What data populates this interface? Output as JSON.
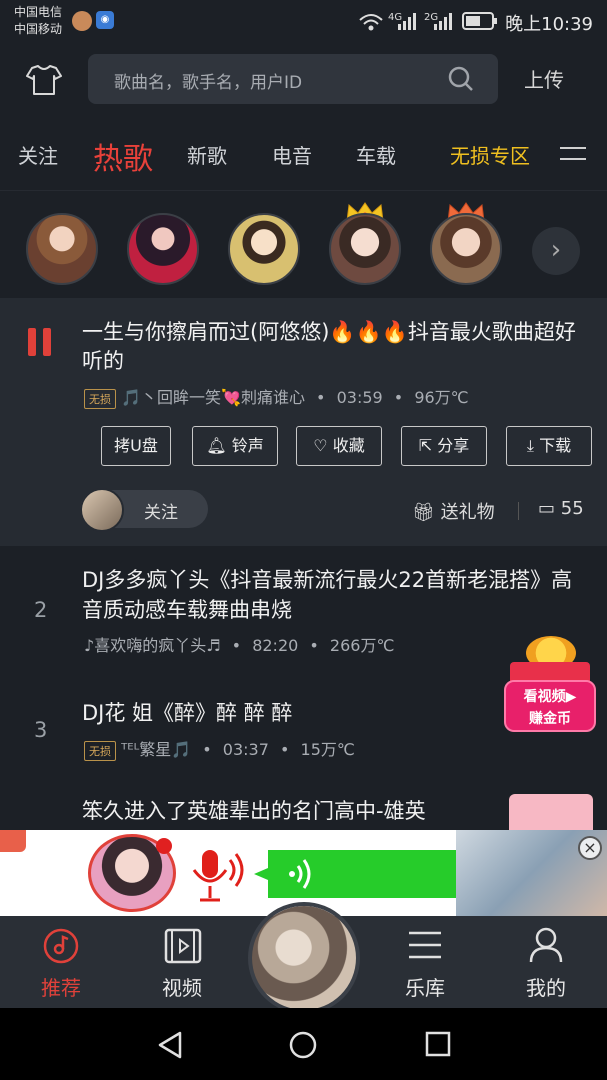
{
  "status_bar": {
    "carrier1": "中国电信",
    "carrier2": "中国移动",
    "time": "晚上10:39",
    "net1": "4G",
    "net2": "2G"
  },
  "header": {
    "search_placeholder": "歌曲名，歌手名，用户ID",
    "upload_label": "上传"
  },
  "tabs": [
    {
      "label": "关注"
    },
    {
      "label": "热歌",
      "active": true
    },
    {
      "label": "新歌"
    },
    {
      "label": "电音"
    },
    {
      "label": "车载"
    },
    {
      "label": "无损专区",
      "highlight": true
    }
  ],
  "now_playing": {
    "title": "一生与你擦肩而过(阿悠悠)🔥🔥🔥抖音最火歌曲超好听的",
    "badge": "无损",
    "uploader": "🎵丶回眸一笑💘刺痛谁心",
    "duration": "03:59",
    "plays": "96万℃",
    "actions": [
      "拷U盘",
      "铃声",
      "收藏",
      "分享",
      "下载"
    ],
    "follow_label": "关注",
    "gift_label": "送礼物",
    "comment_count": "55"
  },
  "songs": [
    {
      "rank": "2",
      "title": "DJ多多疯丫头《抖音最新流行最火22首新老混搭》高音质动感车载舞曲串烧",
      "uploader": "♪喜欢嗨的疯丫头♬",
      "duration": "82:20",
      "plays": "266万℃"
    },
    {
      "rank": "3",
      "title": "DJ花 姐《醉》醉  醉  醉",
      "badge": "无损",
      "uploader": "ᵀᴱᴸ繁星🎵",
      "duration": "03:37",
      "plays": "15万℃"
    },
    {
      "title": "笨久进入了英雄辈出的名门高中-雄英"
    }
  ],
  "ad_bubble": {
    "line1": "看视频▶",
    "line2": "赚金币"
  },
  "bottom_nav": [
    {
      "label": "推荐",
      "icon": "music-disc-icon",
      "active": true
    },
    {
      "label": "视频",
      "icon": "video-icon"
    },
    {
      "label": "乐库",
      "icon": "library-icon"
    },
    {
      "label": "我的",
      "icon": "user-icon"
    }
  ],
  "colors": {
    "accent": "#e0413a",
    "gold": "#f0c020",
    "background": "#1c2026"
  }
}
